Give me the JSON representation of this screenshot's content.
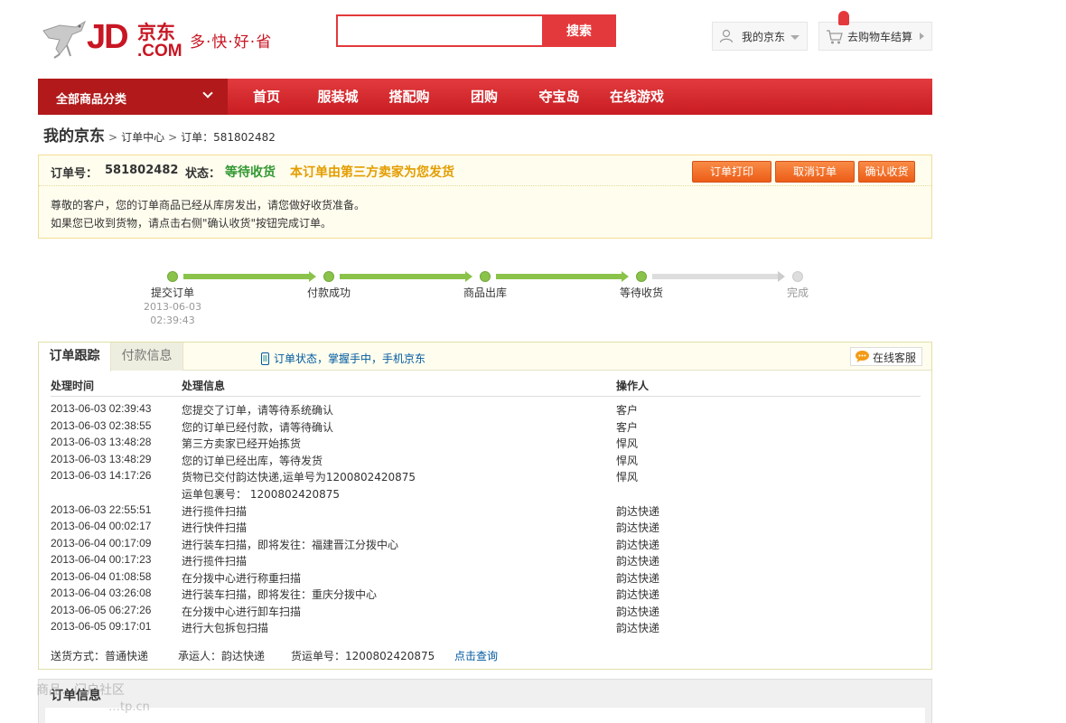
{
  "header": {
    "logo_jd": "JD",
    "logo_cn": "京东",
    "logo_dotcom": ".COM",
    "slogan": "多·快·好·省",
    "search_placeholder": "",
    "search_button": "搜索",
    "my_jd": "我的京东",
    "cart": "去购物车结算"
  },
  "nav": {
    "all_categories": "全部商品分类",
    "items": [
      "首页",
      "服装城",
      "搭配购",
      "团购",
      "夺宝岛",
      "在线游戏"
    ]
  },
  "breadcrumb": {
    "title": "我的京东",
    "sep": ">",
    "order_center": "订单中心",
    "order": "订单：581802482"
  },
  "order": {
    "no_label": "订单号：",
    "no_value": "581802482",
    "status_label": "状态：",
    "status_value": "等待收货",
    "third_party_note": "本订单由第三方卖家为您发货",
    "buttons": {
      "print": "订单打印",
      "cancel": "取消订单",
      "confirm": "确认收货"
    },
    "notice_line1": "尊敬的客户，您的订单商品已经从库房发出，请您做好收货准备。",
    "notice_line2": "如果您已收到货物，请点击右侧\"确认收货\"按钮完成订单。"
  },
  "progress": {
    "steps": [
      {
        "label": "提交订单",
        "done": true
      },
      {
        "label": "付款成功",
        "done": true
      },
      {
        "label": "商品出库",
        "done": true
      },
      {
        "label": "等待收货",
        "done": true
      },
      {
        "label": "完成",
        "done": false
      }
    ],
    "first_date": "2013-06-03",
    "first_time": "02:39:43",
    "colors": {
      "done": "#8bc34a",
      "todo": "#dddddd"
    }
  },
  "tracking": {
    "tab_track": "订单跟踪",
    "tab_payment": "付款信息",
    "mobile_promo": "订单状态，掌握手中，手机京东",
    "customer_service": "在线客服",
    "headers": {
      "time": "处理时间",
      "info": "处理信息",
      "operator": "操作人"
    },
    "rows": [
      {
        "time": "2013-06-03 02:39:43",
        "info": "您提交了订单，请等待系统确认",
        "operator": "客户"
      },
      {
        "time": "2013-06-03 02:38:55",
        "info": "您的订单已经付款，请等待确认",
        "operator": "客户"
      },
      {
        "time": "2013-06-03 13:48:28",
        "info": "第三方卖家已经开始拣货",
        "operator": "悍风"
      },
      {
        "time": "2013-06-03 13:48:29",
        "info": "您的订单已经出库，等待发货",
        "operator": "悍风"
      },
      {
        "time": "2013-06-03 14:17:26",
        "info": "货物已交付韵达快递,运单号为1200802420875",
        "operator": "悍风"
      },
      {
        "time": "",
        "info": "运单包裹号： 1200802420875",
        "operator": ""
      },
      {
        "time": "2013-06-03 22:55:51",
        "info": "进行揽件扫描",
        "operator": "韵达快递"
      },
      {
        "time": "2013-06-04 00:02:17",
        "info": "进行快件扫描",
        "operator": "韵达快递"
      },
      {
        "time": "2013-06-04 00:17:09",
        "info": "进行装车扫描，即将发往：福建晋江分拨中心",
        "operator": "韵达快递"
      },
      {
        "time": "2013-06-04 00:17:23",
        "info": "进行揽件扫描",
        "operator": "韵达快递"
      },
      {
        "time": "2013-06-04 01:08:58",
        "info": "在分拨中心进行称重扫描",
        "operator": "韵达快递"
      },
      {
        "time": "2013-06-04 03:26:08",
        "info": "进行装车扫描，即将发往：重庆分拨中心",
        "operator": "韵达快递"
      },
      {
        "time": "2013-06-05 06:27:26",
        "info": "在分拨中心进行卸车扫描",
        "operator": "韵达快递"
      },
      {
        "time": "2013-06-05 09:17:01",
        "info": "进行大包拆包扫描",
        "operator": "韵达快递"
      }
    ],
    "shipping": {
      "method": "送货方式：普通快递",
      "carrier": "承运人：韵达快递",
      "waybill": "货运单号：1200802420875",
      "query": "点击查询"
    }
  },
  "order_info": {
    "title": "订单信息"
  },
  "watermark": {
    "line1": "商品…门户社区",
    "line2": "…tp.cn"
  },
  "colors": {
    "brand_red": "#e4393c",
    "status_green": "#339933",
    "note_orange": "#e39d00",
    "link_blue": "#005aa0"
  }
}
